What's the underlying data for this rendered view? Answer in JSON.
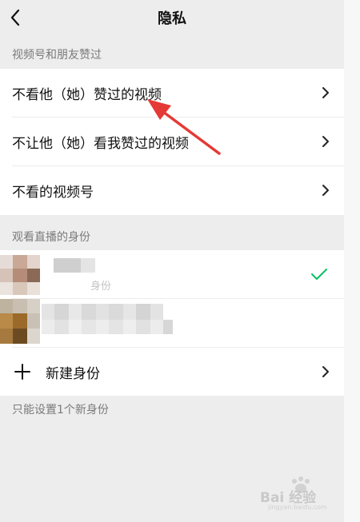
{
  "header": {
    "title": "隐私"
  },
  "sections": [
    {
      "label": "视频号和朋友赞过",
      "items": [
        {
          "label": "不看他（她）赞过的视频"
        },
        {
          "label": "不让他（她）看我赞过的视频"
        },
        {
          "label": "不看的视频号"
        }
      ]
    },
    {
      "label": "观看直播的身份",
      "identities": [
        {
          "name": "身份",
          "selected": true
        },
        {
          "name": ""
        }
      ],
      "new_identity": {
        "label": "新建身份"
      }
    }
  ],
  "footnote": "只能设置1个新身份",
  "watermark": {
    "brand": "Bai 经验",
    "sub": "jingyan.baidu.com"
  },
  "colors": {
    "check": "#07c160",
    "annotation_arrow": "#e53935"
  },
  "icons": {
    "back": "chevron-left",
    "chevron": "chevron-right",
    "check": "check",
    "plus": "plus"
  }
}
